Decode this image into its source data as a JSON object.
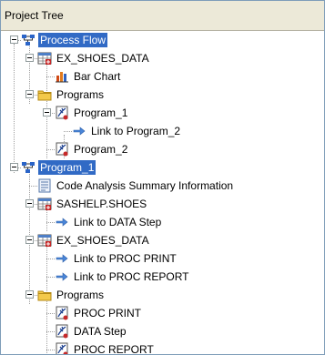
{
  "panel": {
    "title": "Project Tree"
  },
  "tree": [
    {
      "label": "Process Flow",
      "level": 0,
      "icon": "process-flow-icon",
      "expanded": true,
      "selected": true
    },
    {
      "label": "EX_SHOES_DATA",
      "level": 1,
      "icon": "data-table-icon",
      "expanded": true
    },
    {
      "label": "Bar Chart",
      "level": 2,
      "icon": "bar-chart-icon"
    },
    {
      "label": "Programs",
      "level": 1,
      "icon": "folder-icon",
      "expanded": true
    },
    {
      "label": "Program_1",
      "level": 2,
      "icon": "program-icon",
      "expanded": true
    },
    {
      "label": "Link to Program_2",
      "level": 3,
      "icon": "link-arrow-icon"
    },
    {
      "label": "Program_2",
      "level": 2,
      "icon": "program-icon"
    },
    {
      "label": "Program_1",
      "level": 0,
      "icon": "process-flow-icon",
      "expanded": true,
      "selected": true
    },
    {
      "label": "Code Analysis Summary Information",
      "level": 1,
      "icon": "document-icon"
    },
    {
      "label": "SASHELP.SHOES",
      "level": 1,
      "icon": "data-table-icon",
      "expanded": true
    },
    {
      "label": "Link to DATA Step",
      "level": 2,
      "icon": "link-arrow-icon"
    },
    {
      "label": "EX_SHOES_DATA",
      "level": 1,
      "icon": "data-table-icon",
      "expanded": true
    },
    {
      "label": "Link to PROC PRINT",
      "level": 2,
      "icon": "link-arrow-icon"
    },
    {
      "label": "Link to PROC REPORT",
      "level": 2,
      "icon": "link-arrow-icon"
    },
    {
      "label": "Programs",
      "level": 1,
      "icon": "folder-icon",
      "expanded": true
    },
    {
      "label": "PROC PRINT",
      "level": 2,
      "icon": "program-icon"
    },
    {
      "label": "DATA Step",
      "level": 2,
      "icon": "program-icon"
    },
    {
      "label": "PROC REPORT",
      "level": 2,
      "icon": "program-icon"
    }
  ]
}
